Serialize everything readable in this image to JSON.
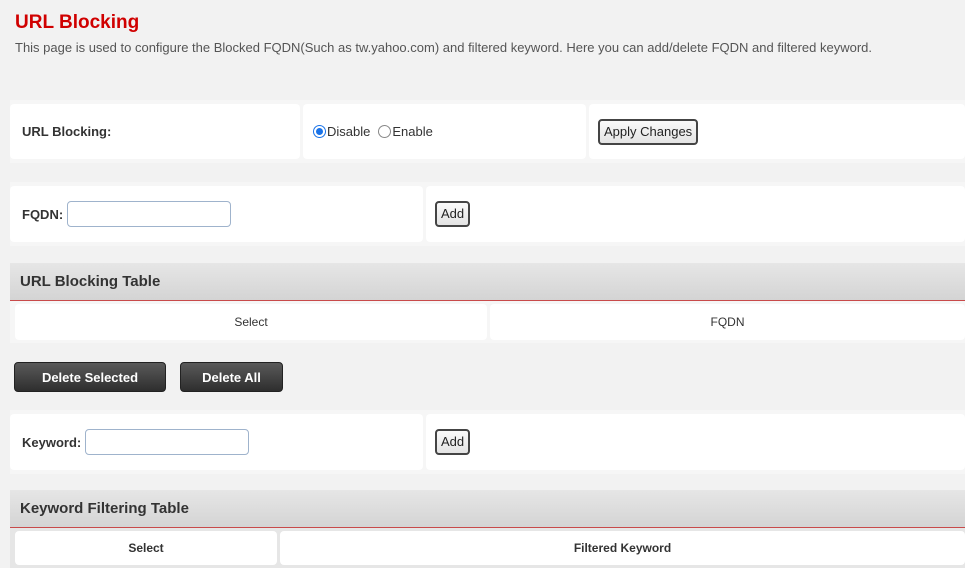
{
  "page": {
    "title": "URL Blocking",
    "description": "This page is used to configure the Blocked FQDN(Such as tw.yahoo.com) and filtered keyword. Here you can add/delete FQDN and filtered keyword."
  },
  "url_blocking": {
    "label": "URL Blocking:",
    "options": [
      "Disable",
      "Enable"
    ],
    "selected": "Disable",
    "apply_label": "Apply Changes"
  },
  "fqdn": {
    "label": "FQDN:",
    "value": "",
    "add_label": "Add"
  },
  "url_table": {
    "title": "URL Blocking Table",
    "columns": [
      "Select",
      "FQDN"
    ]
  },
  "actions": {
    "delete_selected": "Delete Selected",
    "delete_all": "Delete All"
  },
  "keyword": {
    "label": "Keyword:",
    "value": "",
    "add_label": "Add"
  },
  "keyword_table": {
    "title": "Keyword Filtering Table",
    "columns": [
      "Select",
      "Filtered Keyword"
    ]
  }
}
